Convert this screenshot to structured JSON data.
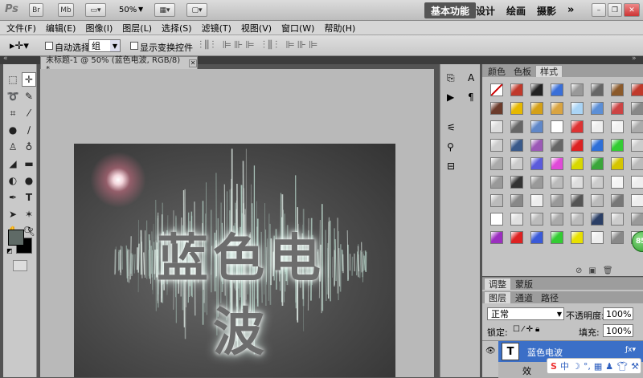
{
  "appbar": {
    "logo": "Ps",
    "br_label": "Br",
    "mb_label": "Mb",
    "zoom": "50%",
    "workspaces": [
      "基本功能",
      "设计",
      "绘画",
      "摄影"
    ],
    "more": "»"
  },
  "menu": [
    "文件(F)",
    "编辑(E)",
    "图像(I)",
    "图层(L)",
    "选择(S)",
    "滤镜(T)",
    "视图(V)",
    "窗口(W)",
    "帮助(H)"
  ],
  "options": {
    "auto_select_label": "自动选择:",
    "group_value": "组",
    "show_transform_label": "显示变换控件"
  },
  "document": {
    "tab_title": "未标题-1 @ 50% (蓝色电波, RGB/8) *",
    "canvas_text": "蓝色电波"
  },
  "styles_panel": {
    "tabs": [
      "颜色",
      "色板",
      "样式"
    ],
    "active_tab": "样式"
  },
  "layers_panel": {
    "top_tabs": [
      "调整",
      "蒙版"
    ],
    "tabs": [
      "图层",
      "通道",
      "路径"
    ],
    "blend_mode": "正常",
    "opacity_label": "不透明度:",
    "opacity_value": "100%",
    "lock_label": "锁定:",
    "fill_label": "填充:",
    "fill_value": "100%",
    "layer_name": "蓝色电波",
    "layer_sub": "效"
  },
  "ime_badge": "85",
  "colors": {
    "foreground": "#5f6a66",
    "background": "#000000",
    "layer_selected": "#3b6fc7"
  }
}
